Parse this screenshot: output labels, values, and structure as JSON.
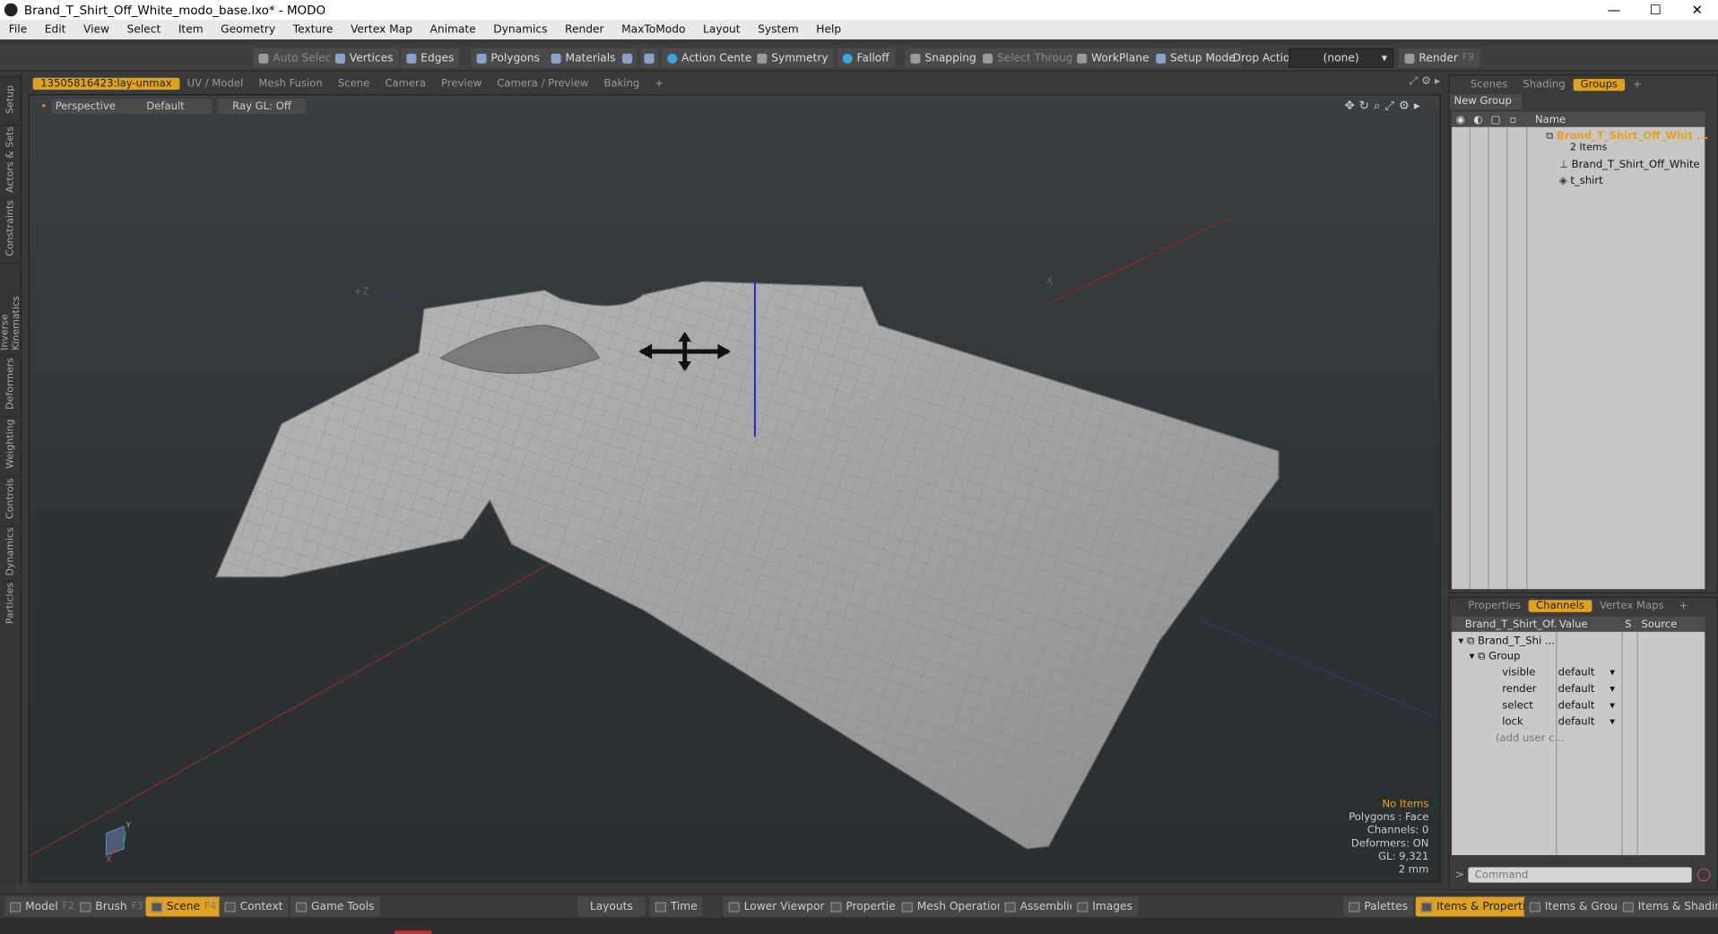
{
  "window": {
    "title": "Brand_T_Shirt_Off_White_modo_base.lxo* - MODO",
    "minimize": "—",
    "maximize": "☐",
    "close": "✕"
  },
  "menu": [
    "File",
    "Edit",
    "View",
    "Select",
    "Item",
    "Geometry",
    "Texture",
    "Vertex Map",
    "Animate",
    "Dynamics",
    "Render",
    "MaxToModo",
    "Layout",
    "System",
    "Help"
  ],
  "toolbar": {
    "auto_select": "Auto Select",
    "vertices": "Vertices",
    "edges": "Edges",
    "polygons": "Polygons",
    "materials": "Materials",
    "action_center": "Action Center",
    "symmetry": "Symmetry",
    "falloff": "Falloff",
    "snapping": "Snapping",
    "select_through": "Select Through",
    "workplane": "WorkPlane",
    "setup_mode": "Setup Mode",
    "drop_action_label": "Drop Action",
    "drop_action_value": "(none)",
    "render": "Render",
    "render_key": "F9"
  },
  "left_tabs": [
    "Setup",
    "Actors & Sets",
    "Constraints",
    "Inverse Kinematics",
    "Deformers",
    "Weighting",
    "Controls",
    "Dynamics",
    "Particles"
  ],
  "viewport_tabs": [
    "13505816423:lay-unmax",
    "UV / Model",
    "Mesh Fusion",
    "Scene",
    "Camera",
    "Preview",
    "Camera / Preview",
    "Baking",
    "+"
  ],
  "viewport_options": {
    "view": "Perspective",
    "shading": "Default",
    "raygl": "Ray GL: Off"
  },
  "viewport_axis_labels": {
    "pz": "+Z",
    "x": "X",
    "gizmo_y": "Y",
    "gizmo_x": "X"
  },
  "hud": {
    "no_items": "No Items",
    "polygons": "Polygons : Face",
    "channels": "Channels: 0",
    "deformers": "Deformers: ON",
    "gl": "GL: 9,321",
    "scale": "2 mm"
  },
  "right_tabs": {
    "scenes": "Scenes",
    "shading": "Shading",
    "groups": "Groups",
    "plus": "+"
  },
  "groups": {
    "new_group": "New Group",
    "name_header": "Name",
    "root": "Brand_T_Shirt_Off_Whit ...",
    "root_count": "2 Items",
    "children": [
      "Brand_T_Shirt_Off_White",
      "t_shirt"
    ]
  },
  "prop_tabs": {
    "properties": "Properties",
    "channels": "Channels",
    "vertex_maps": "Vertex Maps",
    "plus": "+"
  },
  "channels": {
    "headers": [
      "Brand_T_Shirt_Of...",
      "Value",
      "S",
      "Source"
    ],
    "item": "Brand_T_Shi ...",
    "group": "Group",
    "rows": [
      {
        "name": "visible",
        "value": "default"
      },
      {
        "name": "render",
        "value": "default"
      },
      {
        "name": "select",
        "value": "default"
      },
      {
        "name": "lock",
        "value": "default"
      }
    ],
    "add_user": "(add user c..."
  },
  "command": {
    "prompt": ">",
    "placeholder": "Command"
  },
  "bottom": {
    "model": "Model",
    "model_key": "F2",
    "brush": "Brush",
    "brush_key": "F3",
    "scene": "Scene",
    "scene_key": "F4",
    "context": "Context",
    "game_tools": "Game Tools",
    "layouts": "Layouts",
    "time": "Time",
    "lower_viewports": "Lower Viewports",
    "properties": "Properties",
    "mesh_operations": "Mesh Operations",
    "assemblies": "Assemblies",
    "images": "Images",
    "palettes": "Palettes",
    "items_properties": "Items & Properties",
    "items_groups": "Items & Groups",
    "items_shading": "Items & Shading"
  }
}
